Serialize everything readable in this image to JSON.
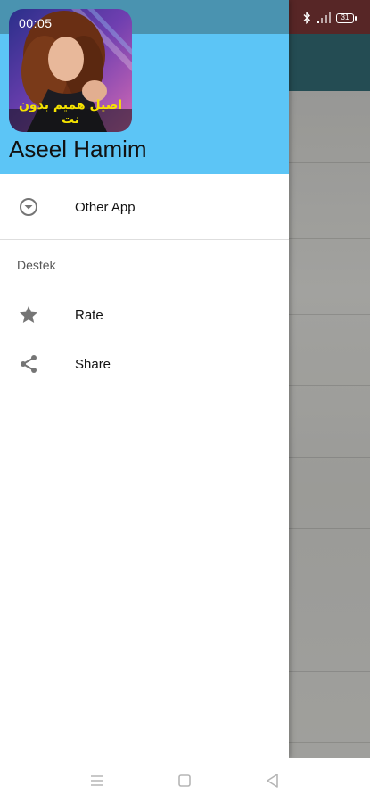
{
  "status_bar": {
    "time": "00:05",
    "battery": "31"
  },
  "drawer": {
    "header": {
      "app_title": "Aseel Hamim",
      "logo_caption": "اصيل هميم بدون نت"
    },
    "items": [
      {
        "label": "Other App",
        "icon": "expand-circle-icon"
      }
    ],
    "section": {
      "title": "Destek",
      "items": [
        {
          "label": "Rate",
          "icon": "star-icon"
        },
        {
          "label": "Share",
          "icon": "share-icon"
        }
      ]
    }
  },
  "colors": {
    "header_bg": "#5cc5f6",
    "header_status_bg": "#4a93b0",
    "icon_gray": "#757575",
    "logo_caption": "#f5e300"
  },
  "system_nav": {
    "buttons": [
      "menu-icon",
      "home-icon",
      "back-icon"
    ]
  }
}
